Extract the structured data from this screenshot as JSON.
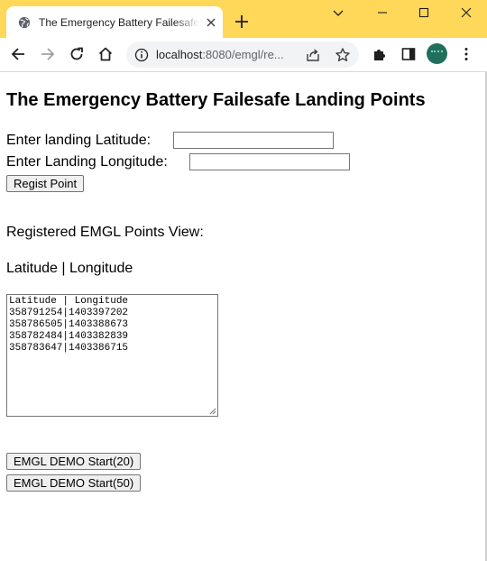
{
  "browser": {
    "tab": {
      "title": "The Emergency Battery Failesafe",
      "favicon": "globe-icon"
    },
    "address": {
      "host": "localhost",
      "path": ":8080/emgl/re..."
    },
    "colors": {
      "frame": "#ffd85a",
      "avatar": "#1f6f5c"
    }
  },
  "page": {
    "heading": "The Emergency Battery Failesafe Landing Points",
    "latitude_label": "Enter landing Latitude:",
    "longitude_label": "Enter Landing Longitude:",
    "latitude_value": "",
    "longitude_value": "",
    "regist_button": "Regist Point",
    "registered_label": "Registered EMGL Points View:",
    "columns_label": "Latitude | Longitude",
    "points_text": "Latitude | Longitude\n358791254|1403397202\n358786505|1403388673\n358782484|1403382839\n358783647|1403386715",
    "demo20_button": "EMGL DEMO Start(20)",
    "demo50_button": "EMGL DEMO Start(50)"
  }
}
